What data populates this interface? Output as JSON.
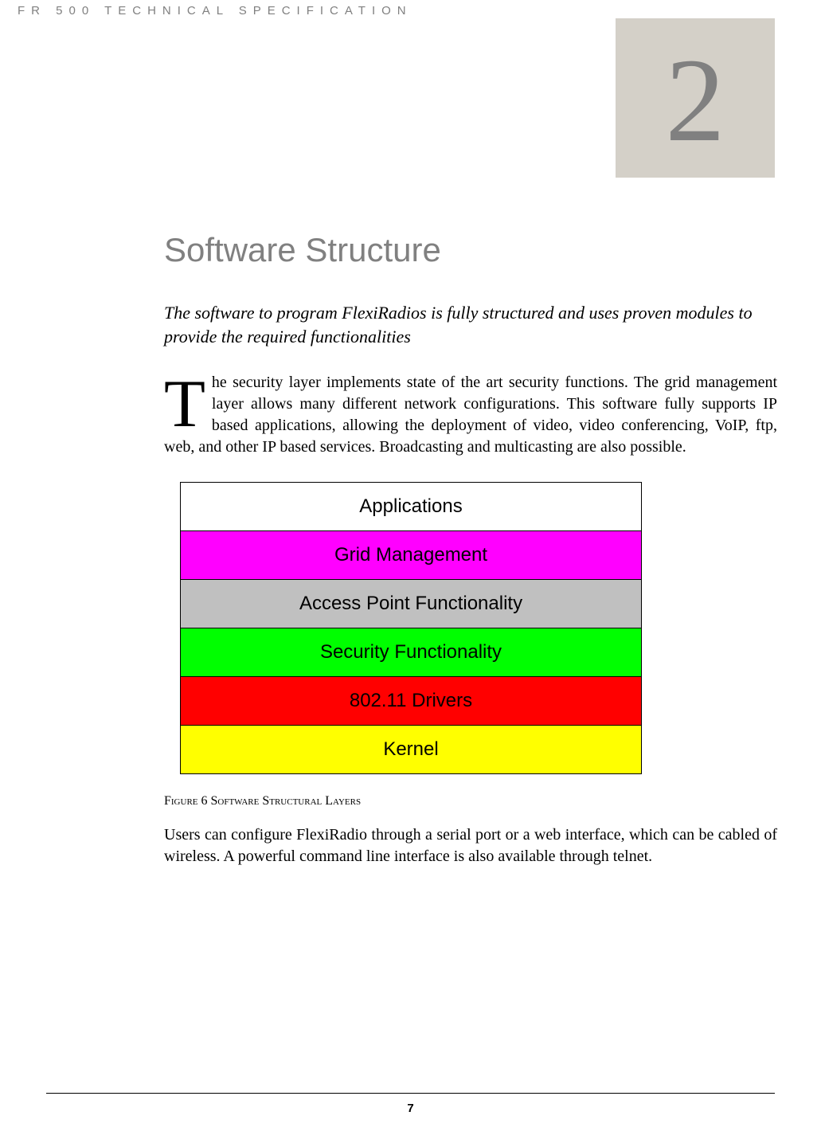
{
  "header": {
    "label": "FR 500 TECHNICAL SPECIFICATION"
  },
  "chapter": {
    "number": "2"
  },
  "main": {
    "title": "Software Structure",
    "subtitle": "The software to program FlexiRadios is fully structured and uses proven modules to provide the required functionalities",
    "dropcap": "T",
    "body1": "he security layer implements state of the art security functions. The grid management layer allows many different network configurations. This software fully supports IP based applications, allowing the deployment of video, video conferencing, VoIP, ftp, web, and other IP based services. Broadcasting and multicasting are also possible.",
    "figure_caption": "Figure 6 Software Structural Layers",
    "body2": "Users can configure FlexiRadio through a serial port or a web interface, which can be cabled of wireless. A powerful command line interface is also available through telnet."
  },
  "chart_data": {
    "type": "table",
    "title": "Software Structural Layers",
    "layers": [
      {
        "name": "Applications",
        "color": "#ffffff"
      },
      {
        "name": "Grid Management",
        "color": "#ff00ff"
      },
      {
        "name": "Access Point Functionality",
        "color": "#c0c0c0"
      },
      {
        "name": "Security Functionality",
        "color": "#00ff00"
      },
      {
        "name": "802.11 Drivers",
        "color": "#ff0000"
      },
      {
        "name": "Kernel",
        "color": "#ffff00"
      }
    ]
  },
  "footer": {
    "page_number": "7"
  }
}
